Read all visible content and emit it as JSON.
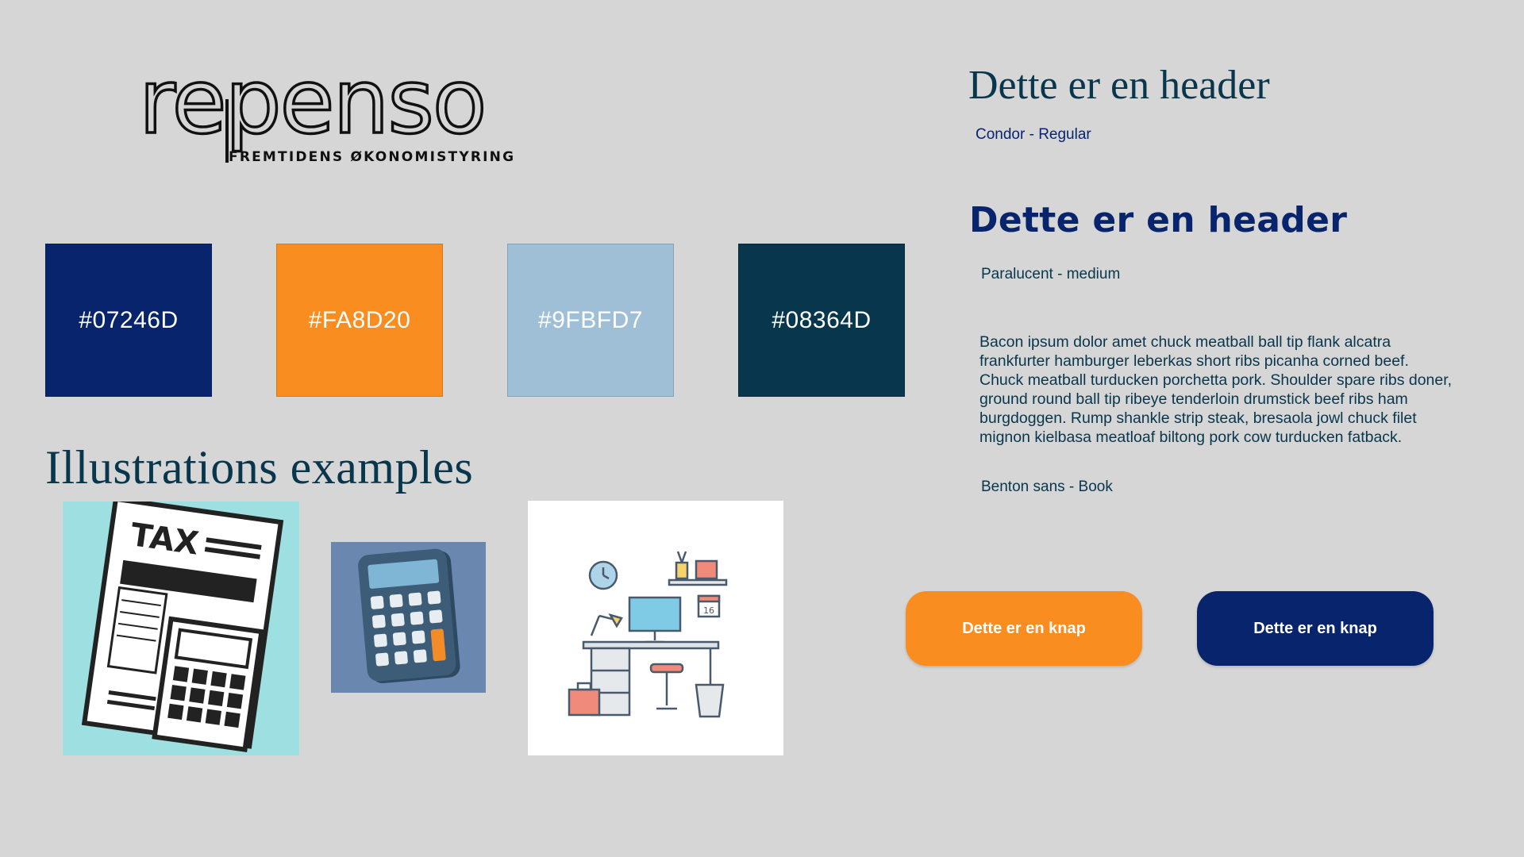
{
  "logo": {
    "wordmark": "repenso",
    "tagline": "FREMTIDENS ØKONOMISTYRING"
  },
  "swatches": [
    {
      "label": "#07246D",
      "color": "#07246D"
    },
    {
      "label": "#FA8D20",
      "color": "#FA8D20"
    },
    {
      "label": "#9FBFD7",
      "color": "#9FBFD7"
    },
    {
      "label": "#08364D",
      "color": "#08364D"
    }
  ],
  "illustrations": {
    "title": "Illustrations examples",
    "items": [
      {
        "name": "tax-calculator-illustration",
        "text": "TAX"
      },
      {
        "name": "calculator-illustration"
      },
      {
        "name": "desk-workspace-illustration",
        "calendar_day": "16"
      }
    ]
  },
  "typography": {
    "header_serif": "Dette er en header",
    "header_serif_caption": "Condor - Regular",
    "header_sans": "Dette er en header",
    "header_sans_caption": "Paralucent - medium",
    "body": "Bacon ipsum dolor amet chuck meatball ball tip flank alcatra frankfurter hamburger leberkas short ribs picanha corned beef. Chuck meatball turducken porchetta pork. Shoulder spare ribs doner, ground round ball tip ribeye tenderloin drumstick beef ribs ham burgdoggen. Rump shankle strip steak, bresaola jowl chuck filet mignon kielbasa meatloaf biltong pork cow turducken fatback.",
    "body_caption": "Benton sans - Book"
  },
  "buttons": {
    "primary_label": "Dette er en knap",
    "secondary_label": "Dette er en knap"
  },
  "colors": {
    "background": "#d6d6d6",
    "navy": "#07246D",
    "orange": "#FA8D20",
    "light_blue": "#9FBFD7",
    "dark_teal": "#08364D"
  }
}
